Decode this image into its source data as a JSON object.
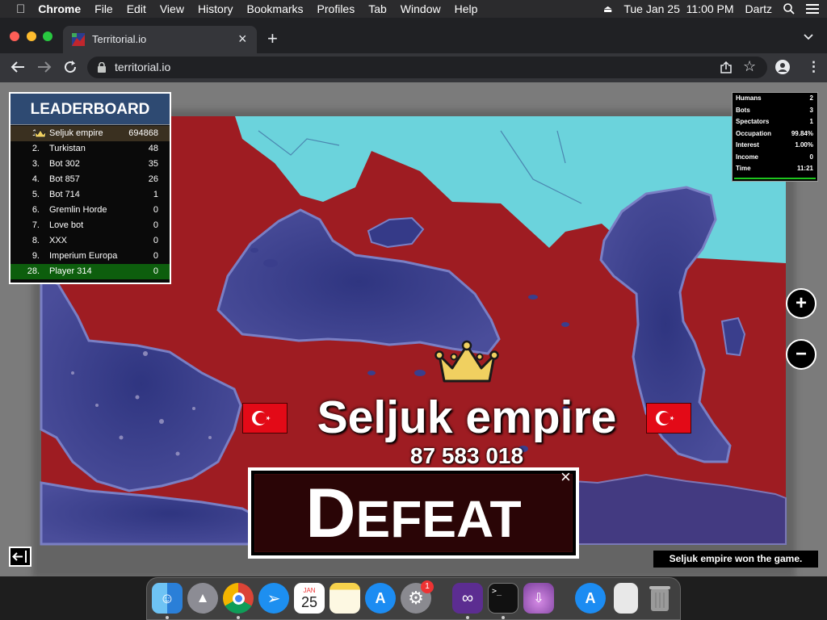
{
  "menubar": {
    "app": "Chrome",
    "items": [
      "File",
      "Edit",
      "View",
      "History",
      "Bookmarks",
      "Profiles",
      "Tab",
      "Window",
      "Help"
    ],
    "datetime": "Tue Jan 25  11:00 PM",
    "user": "Dartz"
  },
  "browser": {
    "tab_title": "Territorial.io",
    "url": "territorial.io"
  },
  "leaderboard": {
    "title": "LEADERBOARD",
    "rows": [
      {
        "rank": "1.",
        "name": "Seljuk empire",
        "score": "694868"
      },
      {
        "rank": "2.",
        "name": "Turkistan",
        "score": "48"
      },
      {
        "rank": "3.",
        "name": "Bot 302",
        "score": "35"
      },
      {
        "rank": "4.",
        "name": "Bot 857",
        "score": "26"
      },
      {
        "rank": "5.",
        "name": "Bot 714",
        "score": "1"
      },
      {
        "rank": "6.",
        "name": "Gremlin Horde",
        "score": "0"
      },
      {
        "rank": "7.",
        "name": "Love bot",
        "score": "0"
      },
      {
        "rank": "8.",
        "name": "XXX",
        "score": "0"
      },
      {
        "rank": "9.",
        "name": "Imperium Europa",
        "score": "0"
      },
      {
        "rank": "28.",
        "name": "Player 314",
        "score": "0"
      }
    ]
  },
  "stats": [
    {
      "label": "Humans",
      "value": "2"
    },
    {
      "label": "Bots",
      "value": "3"
    },
    {
      "label": "Spectators",
      "value": "1"
    },
    {
      "label": "Occupation",
      "value": "99.84%"
    },
    {
      "label": "Interest",
      "value": "1.00%"
    },
    {
      "label": "Income",
      "value": "0"
    },
    {
      "label": "Time",
      "value": "11:21"
    }
  ],
  "winner": {
    "name": "Seljuk empire",
    "score": "87 583 018"
  },
  "result": {
    "first_letter": "D",
    "rest": "EFEAT"
  },
  "status_message": "Seljuk empire won the game.",
  "zoom": {
    "in": "+",
    "out": "−"
  },
  "dock_icons": [
    "finder-icon",
    "launchpad-icon",
    "chrome-icon",
    "safari-icon",
    "calendar-icon",
    "notes-icon",
    "app-store-icon",
    "system-preferences-icon",
    "visual-studio-icon",
    "terminal-icon",
    "installer-icon",
    "app-store-icon",
    "document-icon",
    "trash-icon"
  ],
  "dock": {
    "calendar_month": "JAN",
    "calendar_day": "25",
    "badge": "1",
    "terminal_prompt": ">_"
  },
  "colors": {
    "territory": "#9e1c22",
    "sea": "#3a3e8c",
    "ice": "#6bd3dc",
    "leaderboard_header": "#2e4a72",
    "player_row": "#0d5e0d",
    "crown": "#f0d060"
  }
}
